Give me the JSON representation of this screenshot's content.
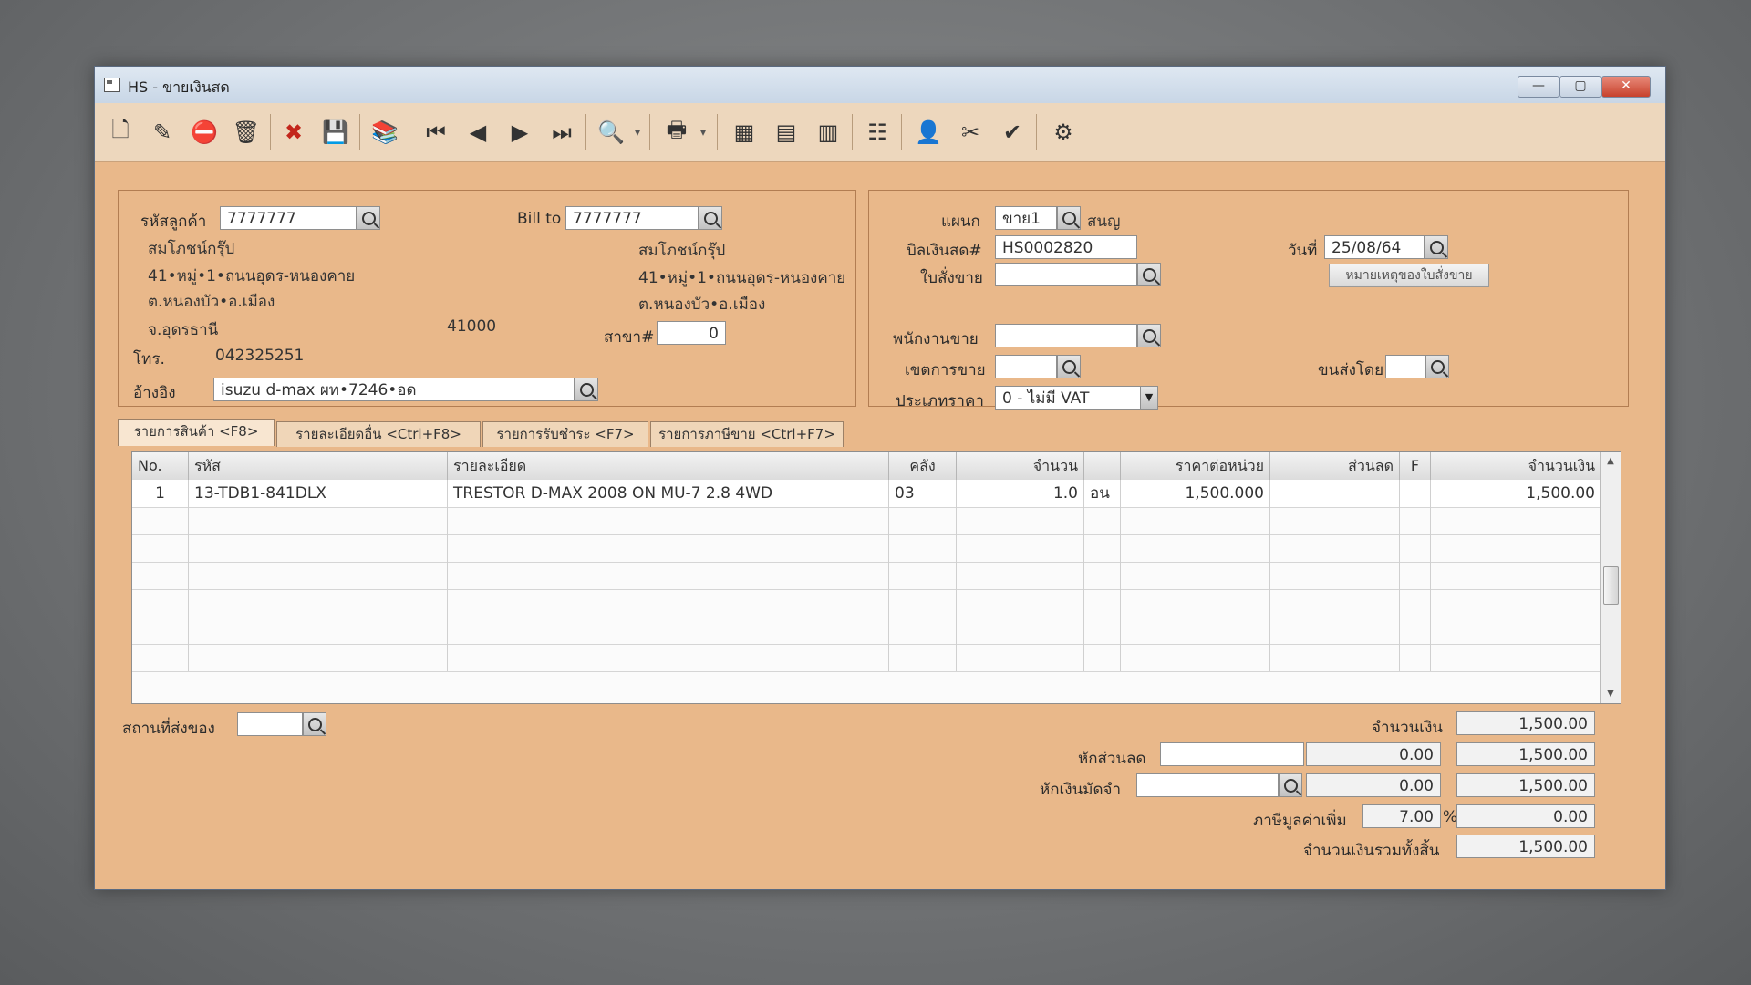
{
  "window": {
    "title": "HS - ขายเงินสด",
    "min": "—",
    "max": "▢",
    "close": "✕"
  },
  "toolbar": [
    {
      "name": "new-document-icon",
      "glyph": "🗋"
    },
    {
      "name": "edit-icon",
      "glyph": "✎"
    },
    {
      "name": "void-icon",
      "glyph": "⛔"
    },
    {
      "name": "trash-icon",
      "glyph": "🗑"
    },
    {
      "name": "cancel-icon",
      "glyph": "✖"
    },
    {
      "name": "save-icon",
      "glyph": "💾"
    },
    {
      "name": "stack-icon",
      "glyph": "📚"
    },
    {
      "name": "first-record-icon",
      "glyph": "⏮"
    },
    {
      "name": "previous-record-icon",
      "glyph": "◀"
    },
    {
      "name": "next-record-icon",
      "glyph": "▶"
    },
    {
      "name": "last-record-icon",
      "glyph": "⏭"
    },
    {
      "name": "preview-icon",
      "glyph": "🔍"
    },
    {
      "name": "preview-dropdown-icon",
      "glyph": "▾"
    },
    {
      "name": "print-icon",
      "glyph": "🖶"
    },
    {
      "name": "print-dropdown-icon",
      "glyph": "▾"
    },
    {
      "name": "calculator-icon",
      "glyph": "▦"
    },
    {
      "name": "cash-register-icon",
      "glyph": "▤"
    },
    {
      "name": "report-icon",
      "glyph": "▥"
    },
    {
      "name": "table-icon",
      "glyph": "☷"
    },
    {
      "name": "approve-user-icon",
      "glyph": "👤"
    },
    {
      "name": "tools-icon",
      "glyph": "✂"
    },
    {
      "name": "ok-icon",
      "glyph": "✔"
    },
    {
      "name": "settings-icon",
      "glyph": "⚙"
    }
  ],
  "customer": {
    "code_label": "รหัสลูกค้า",
    "code": "7777777",
    "name": "สมโภชน์กรุ๊ป",
    "addr1": "41•หมู่•1•ถนนอุดร-หนองคาย",
    "addr2": "ต.หนองบัว•อ.เมือง",
    "addr3": "จ.อุดรธานี",
    "zip": "41000",
    "phone_label": "โทร.",
    "phone": "042325251",
    "ref_label": "อ้างอิง",
    "ref": "isuzu d-max ผท•7246•อด"
  },
  "billto": {
    "label": "Bill to",
    "code": "7777777",
    "name": "สมโภชน์กรุ๊ป",
    "addr1": "41•หมู่•1•ถนนอุดร-หนองคาย",
    "addr2": "ต.หนองบัว•อ.เมือง",
    "branch_label": "สาขา#",
    "branch": "0"
  },
  "right": {
    "dept_label": "แผนก",
    "dept": "ขาย1",
    "dept_name": "สนญ",
    "bill_label": "บิลเงินสด#",
    "bill": "HS0002820",
    "date_label": "วันที่",
    "date": "25/08/64",
    "order_label": "ใบสั่งขาย",
    "order": "",
    "order_note": "หมายเหตุของใบสั่งขาย",
    "sales_label": "พนักงานขาย",
    "sales": "",
    "area_label": "เขตการขาย",
    "area": "",
    "ship_label": "ขนส่งโดย",
    "ship": "",
    "price_label": "ประเภทราคา",
    "price": "0 - ไม่มี VAT"
  },
  "tabs": [
    "รายการสินค้า <F8>",
    "รายละเอียดอื่น <Ctrl+F8>",
    "รายการรับชำระ <F7>",
    "รายการภาษีขาย <Ctrl+F7>"
  ],
  "grid": {
    "headers": [
      "No.",
      "รหัส",
      "รายละเอียด",
      "คลัง",
      "จำนวน",
      "",
      "ราคาต่อหน่วย",
      "ส่วนลด",
      "F",
      "จำนวนเงิน"
    ],
    "rows": [
      [
        "1",
        "13-TDB1-841DLX",
        "TRESTOR D-MAX 2008 ON MU-7 2.8 4WD",
        "03",
        "1.0",
        "อน",
        "1,500.000",
        "",
        "",
        "1,500.00"
      ]
    ],
    "empty_rows": 6
  },
  "footer": {
    "delivery_label": "สถานที่ส่งของ",
    "delivery": "",
    "amount_label": "จำนวนเงิน",
    "amount": "1,500.00",
    "discount_label": "หักส่วนลด",
    "discount_code": "",
    "discount": "0.00",
    "after_discount": "1,500.00",
    "deposit_label": "หักเงินมัดจำ",
    "deposit_code": "",
    "deposit": "0.00",
    "after_deposit": "1,500.00",
    "vat_label": "ภาษีมูลค่าเพิ่ม",
    "vat_rate": "7.00",
    "vat_unit": "%",
    "vat": "0.00",
    "total_label": "จำนวนเงินรวมทั้งสิ้น",
    "total": "1,500.00"
  }
}
